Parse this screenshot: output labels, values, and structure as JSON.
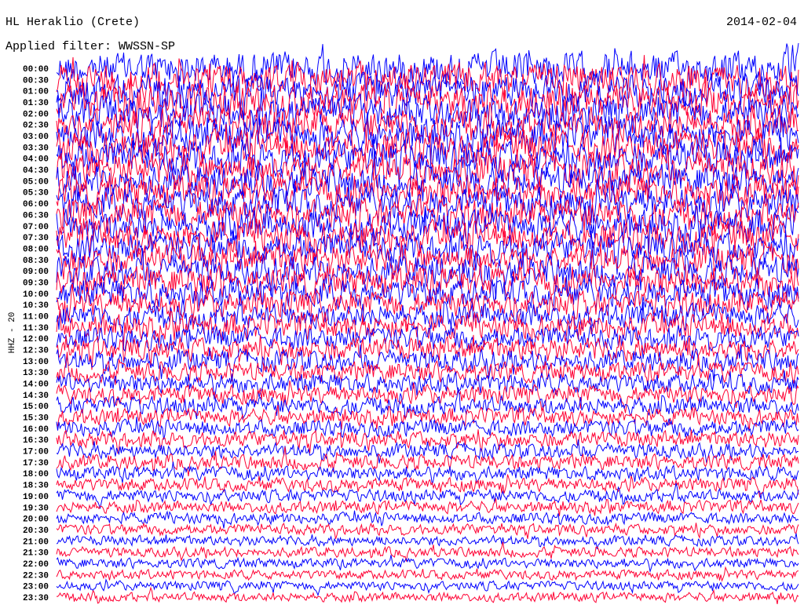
{
  "header": {
    "station": "HL Heraklio (Crete)",
    "date": "2014-02-04",
    "filter": "Applied filter: WWSSN-SP",
    "channel": "HHZ - 20"
  },
  "chart_data": {
    "type": "line",
    "title": "HL Heraklio (Crete)",
    "subtitle": "Applied filter: WWSSN-SP",
    "ylabel": "HHZ - 20",
    "row_labels": [
      "00:00",
      "00:30",
      "01:00",
      "01:30",
      "02:00",
      "02:30",
      "03:00",
      "03:30",
      "04:00",
      "04:30",
      "05:00",
      "05:30",
      "06:00",
      "06:30",
      "07:00",
      "07:30",
      "08:00",
      "08:30",
      "09:00",
      "09:30",
      "10:00",
      "10:30",
      "11:00",
      "11:30",
      "12:00",
      "12:30",
      "13:00",
      "13:30",
      "14:00",
      "14:30",
      "15:00",
      "15:30",
      "16:00",
      "16:30",
      "17:00",
      "17:30",
      "18:00",
      "18:30",
      "19:00",
      "19:30",
      "20:00",
      "20:30",
      "21:00",
      "21:30",
      "22:00",
      "22:30",
      "23:00",
      "23:30"
    ],
    "colors": [
      "#0000ff",
      "#ff0033"
    ],
    "relative_amplitude": [
      1.0,
      1.0,
      1.0,
      1.0,
      1.0,
      1.0,
      1.0,
      1.0,
      1.0,
      1.0,
      0.95,
      0.95,
      0.95,
      0.95,
      0.95,
      0.95,
      0.9,
      0.9,
      0.9,
      0.9,
      0.85,
      0.8,
      0.75,
      0.75,
      0.7,
      0.7,
      0.65,
      0.6,
      0.6,
      0.55,
      0.55,
      0.5,
      0.5,
      0.48,
      0.45,
      0.45,
      0.42,
      0.4,
      0.38,
      0.36,
      0.34,
      0.32,
      0.3,
      0.3,
      0.3,
      0.28,
      0.28,
      0.28
    ]
  }
}
